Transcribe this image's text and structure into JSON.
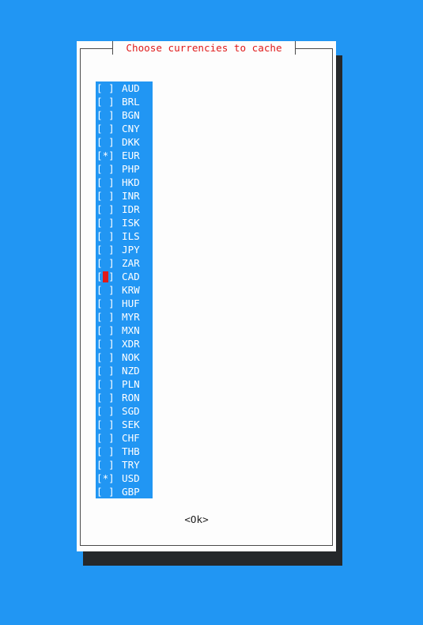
{
  "dialog": {
    "title": " Choose currencies to cache ",
    "ok_label": "<Ok>"
  },
  "currencies": [
    {
      "code": "AUD",
      "mark": "[ ]"
    },
    {
      "code": "BRL",
      "mark": "[ ]"
    },
    {
      "code": "BGN",
      "mark": "[ ]"
    },
    {
      "code": "CNY",
      "mark": "[ ]"
    },
    {
      "code": "DKK",
      "mark": "[ ]"
    },
    {
      "code": "EUR",
      "mark": "[*]"
    },
    {
      "code": "PHP",
      "mark": "[ ]"
    },
    {
      "code": "HKD",
      "mark": "[ ]"
    },
    {
      "code": "INR",
      "mark": "[ ]"
    },
    {
      "code": "IDR",
      "mark": "[ ]"
    },
    {
      "code": "ISK",
      "mark": "[ ]"
    },
    {
      "code": "ILS",
      "mark": "[ ]"
    },
    {
      "code": "JPY",
      "mark": "[ ]"
    },
    {
      "code": "ZAR",
      "mark": "[ ]"
    },
    {
      "code": "CAD",
      "mark": "[ ]"
    },
    {
      "code": "KRW",
      "mark": "[ ]"
    },
    {
      "code": "HUF",
      "mark": "[ ]"
    },
    {
      "code": "MYR",
      "mark": "[ ]"
    },
    {
      "code": "MXN",
      "mark": "[ ]"
    },
    {
      "code": "XDR",
      "mark": "[ ]"
    },
    {
      "code": "NOK",
      "mark": "[ ]"
    },
    {
      "code": "NZD",
      "mark": "[ ]"
    },
    {
      "code": "PLN",
      "mark": "[ ]"
    },
    {
      "code": "RON",
      "mark": "[ ]"
    },
    {
      "code": "SGD",
      "mark": "[ ]"
    },
    {
      "code": "SEK",
      "mark": "[ ]"
    },
    {
      "code": "CHF",
      "mark": "[ ]"
    },
    {
      "code": "THB",
      "mark": "[ ]"
    },
    {
      "code": "TRY",
      "mark": "[ ]"
    },
    {
      "code": "USD",
      "mark": "[*]"
    },
    {
      "code": "GBP",
      "mark": "[ ]"
    }
  ],
  "colors": {
    "background": "#2196F3",
    "list_highlight": "#2196F3",
    "dialog": "#fdfdfd",
    "title": "#e01b1b",
    "cursor": "#e01b1b",
    "shadow": "#25282b"
  }
}
